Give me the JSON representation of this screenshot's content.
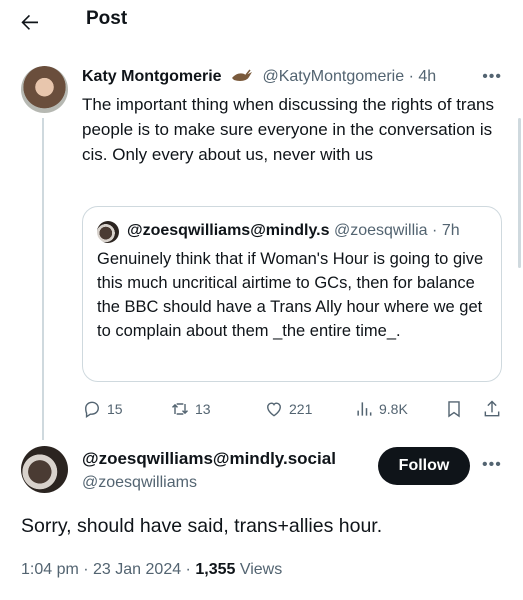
{
  "header": {
    "title": "Post"
  },
  "tweet": {
    "author_name": "Katy Montgomerie",
    "author_handle": "@KatyMontgomerie",
    "separator": "·",
    "time": "4h",
    "text": "The important thing when discussing the rights of trans people is to make sure everyone in the conversation is cis. Only every about us, never with us",
    "quote": {
      "author_name": "@zoesqwilliams@mindly.s",
      "author_handle": "@zoesqwillia",
      "time": "7h",
      "text": "Genuinely think that if Woman's Hour is going to give this much uncritical airtime to GCs, then for balance the BBC should have a Trans Ally hour where we get to complain about them _the entire time_."
    },
    "stats": {
      "replies": "15",
      "reposts": "13",
      "likes": "221",
      "views": "9.8K"
    }
  },
  "reply": {
    "author_name": "@zoesqwilliams@mindly.social",
    "author_handle": "@zoesqwilliams",
    "follow_label": "Follow",
    "text": "Sorry, should have said, trans+allies hour.",
    "timestamp": "1:04 pm · 23 Jan 2024 ·",
    "views_count": "1,355",
    "views_label": "Views"
  },
  "icons": [
    "back-arrow-icon",
    "bird-emoji-icon",
    "more-icon",
    "reply-icon",
    "repost-icon",
    "like-icon",
    "views-icon",
    "bookmark-icon",
    "share-icon"
  ],
  "colors": {
    "text": "#0f1419",
    "muted": "#536471",
    "border": "#cfd9de",
    "follow_bg": "#0f1419"
  }
}
